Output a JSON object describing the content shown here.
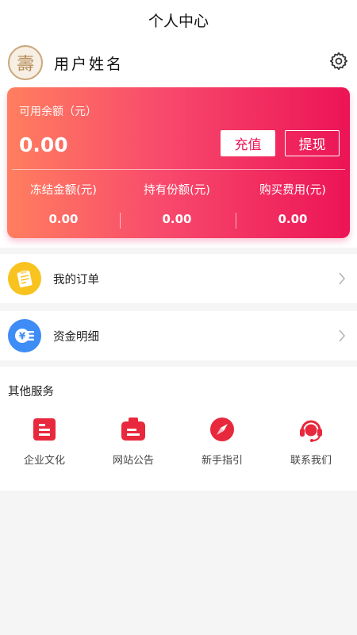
{
  "header": {
    "title": "个人中心"
  },
  "profile": {
    "avatar_glyph": "壽",
    "username": "用户姓名",
    "settings_icon": "gear-icon"
  },
  "balance": {
    "label": "可用余额（元）",
    "value": "0.00",
    "recharge_label": "充值",
    "withdraw_label": "提现",
    "stats": [
      {
        "label": "冻结金额(元)",
        "value": "0.00"
      },
      {
        "label": "持有份额(元)",
        "value": "0.00"
      },
      {
        "label": "购买费用(元)",
        "value": "0.00"
      }
    ]
  },
  "menu": [
    {
      "label": "我的订单",
      "icon": "order-icon",
      "color": "#f9c31f"
    },
    {
      "label": "资金明细",
      "icon": "fund-detail-icon",
      "color": "#3e8cf5"
    }
  ],
  "services": {
    "title": "其他服务",
    "items": [
      {
        "label": "企业文化",
        "icon": "culture-icon"
      },
      {
        "label": "网站公告",
        "icon": "announcement-icon"
      },
      {
        "label": "新手指引",
        "icon": "compass-icon"
      },
      {
        "label": "联系我们",
        "icon": "headset-icon"
      }
    ]
  },
  "colors": {
    "accent": "#ec1456",
    "gradient_start": "#ff7e5f",
    "gradient_end": "#ec1456",
    "service_icon": "#e8283c"
  }
}
